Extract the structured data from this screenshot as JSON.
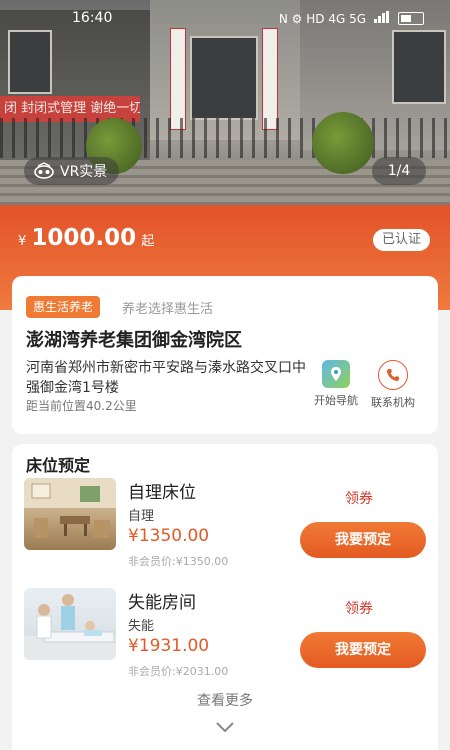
{
  "status_bar": {
    "time": "16:40",
    "indicators": "N  ⚙  HD 4G 5G"
  },
  "hero": {
    "banner_text": "闭 封闭式管理 谢绝一切探",
    "vr_label": "VR实景",
    "counter": "1/4"
  },
  "price": {
    "currency": "¥",
    "amount": "1000.00",
    "suffix": "起",
    "certified_label": "已认证"
  },
  "facility": {
    "tag": "惠生活养老",
    "slogan": "养老选择惠生活",
    "name": "澎湖湾养老集团御金湾院区",
    "address": "河南省郑州市新密市平安路与溱水路交叉口中强御金湾1号楼",
    "distance": "距当前位置40.2公里",
    "nav_label": "开始导航",
    "contact_label": "联系机构"
  },
  "beds": {
    "section_title": "床位预定",
    "rooms": [
      {
        "title": "自理床位",
        "type": "自理",
        "price": "¥1350.00",
        "member_price": "非会员价:¥1350.00",
        "coupon": "领券",
        "book_label": "我要预定"
      },
      {
        "title": "失能房间",
        "type": "失能",
        "price": "¥1931.00",
        "member_price": "非会员价:¥2031.00",
        "coupon": "领券",
        "book_label": "我要预定"
      }
    ],
    "more_label": "查看更多"
  },
  "colors": {
    "accent": "#e45a22",
    "price_band": "#ea6a35",
    "coupon": "#d23a2a"
  }
}
